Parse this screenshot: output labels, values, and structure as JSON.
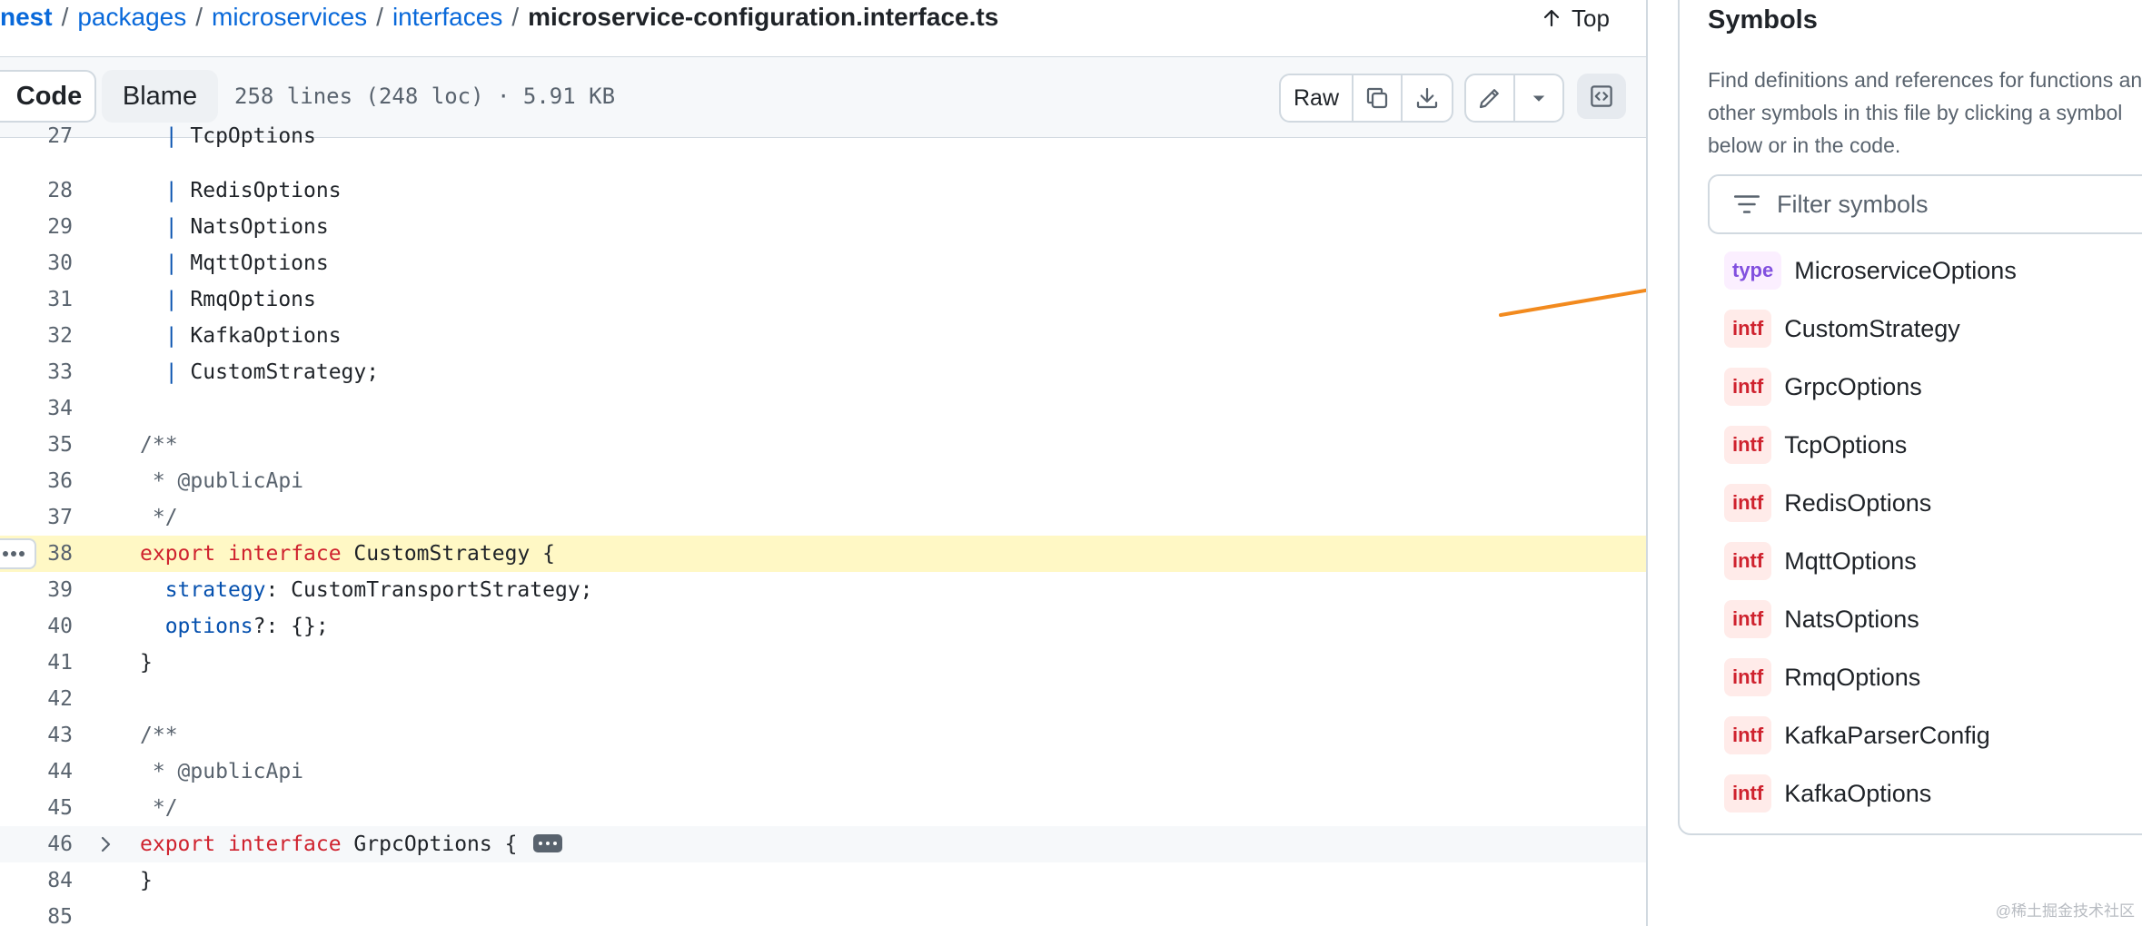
{
  "breadcrumb": {
    "items": [
      "nest",
      "packages",
      "microservices",
      "interfaces"
    ],
    "separator": "/",
    "current": "microservice-configuration.interface.ts",
    "top_label": "Top"
  },
  "file_header": {
    "tabs": [
      "Code",
      "Blame"
    ],
    "active_tab": "Code",
    "file_info": "258 lines (248 loc) · 5.91 KB",
    "raw_label": "Raw",
    "icons": [
      "copy-icon",
      "download-icon",
      "pencil-icon",
      "triangle-down-icon",
      "code-square-icon"
    ]
  },
  "code": {
    "partial_line": {
      "num": "27",
      "text": "TcpOptions"
    },
    "lines": [
      {
        "num": "28",
        "tokens": [
          [
            "pipe",
            "  | "
          ],
          [
            "",
            "RedisOptions"
          ]
        ]
      },
      {
        "num": "29",
        "tokens": [
          [
            "pipe",
            "  | "
          ],
          [
            "",
            "NatsOptions"
          ]
        ]
      },
      {
        "num": "30",
        "tokens": [
          [
            "pipe",
            "  | "
          ],
          [
            "",
            "MqttOptions"
          ]
        ]
      },
      {
        "num": "31",
        "tokens": [
          [
            "pipe",
            "  | "
          ],
          [
            "",
            "RmqOptions"
          ]
        ]
      },
      {
        "num": "32",
        "tokens": [
          [
            "pipe",
            "  | "
          ],
          [
            "",
            "KafkaOptions"
          ]
        ]
      },
      {
        "num": "33",
        "tokens": [
          [
            "pipe",
            "  | "
          ],
          [
            "",
            "CustomStrategy;"
          ]
        ]
      },
      {
        "num": "34",
        "tokens": []
      },
      {
        "num": "35",
        "tokens": [
          [
            "cm",
            "/**"
          ]
        ]
      },
      {
        "num": "36",
        "tokens": [
          [
            "cm",
            " * @publicApi"
          ]
        ]
      },
      {
        "num": "37",
        "tokens": [
          [
            "cm",
            " */"
          ]
        ]
      },
      {
        "num": "38",
        "highlight": true,
        "tokens": [
          [
            "kw",
            "export"
          ],
          [
            "",
            " "
          ],
          [
            "kw",
            "interface"
          ],
          [
            "",
            " CustomStrategy {"
          ]
        ]
      },
      {
        "num": "39",
        "tokens": [
          [
            "",
            "  "
          ],
          [
            "pr",
            "strategy"
          ],
          [
            "",
            ": CustomTransportStrategy;"
          ]
        ]
      },
      {
        "num": "40",
        "tokens": [
          [
            "",
            "  "
          ],
          [
            "pr",
            "options"
          ],
          [
            "",
            "?: {};"
          ]
        ]
      },
      {
        "num": "41",
        "tokens": [
          [
            "",
            "}"
          ]
        ]
      },
      {
        "num": "42",
        "tokens": []
      },
      {
        "num": "43",
        "tokens": [
          [
            "cm",
            "/**"
          ]
        ]
      },
      {
        "num": "44",
        "tokens": [
          [
            "cm",
            " * @publicApi"
          ]
        ]
      },
      {
        "num": "45",
        "tokens": [
          [
            "cm",
            " */"
          ]
        ]
      },
      {
        "num": "46",
        "folded": true,
        "tokens": [
          [
            "kw",
            "export"
          ],
          [
            "",
            " "
          ],
          [
            "kw",
            "interface"
          ],
          [
            "",
            " GrpcOptions {"
          ]
        ]
      },
      {
        "num": "84",
        "tokens": [
          [
            "",
            "}"
          ]
        ]
      },
      {
        "num": "85",
        "tokens": []
      }
    ]
  },
  "symbols": {
    "title": "Symbols",
    "description": [
      "Find definitions and references for functions and",
      "other symbols in this file by clicking a symbol",
      "below or in the code."
    ],
    "filter_placeholder": "Filter symbols",
    "items": [
      {
        "kind": "type",
        "name": "MicroserviceOptions"
      },
      {
        "kind": "intf",
        "name": "CustomStrategy"
      },
      {
        "kind": "intf",
        "name": "GrpcOptions"
      },
      {
        "kind": "intf",
        "name": "TcpOptions"
      },
      {
        "kind": "intf",
        "name": "RedisOptions"
      },
      {
        "kind": "intf",
        "name": "MqttOptions"
      },
      {
        "kind": "intf",
        "name": "NatsOptions"
      },
      {
        "kind": "intf",
        "name": "RmqOptions"
      },
      {
        "kind": "intf",
        "name": "KafkaParserConfig"
      },
      {
        "kind": "intf",
        "name": "KafkaOptions"
      }
    ]
  },
  "annotation": {
    "color": "#f28a1e",
    "points_to": "MicroserviceOptions"
  },
  "watermark": "@稀土掘金技术社区"
}
